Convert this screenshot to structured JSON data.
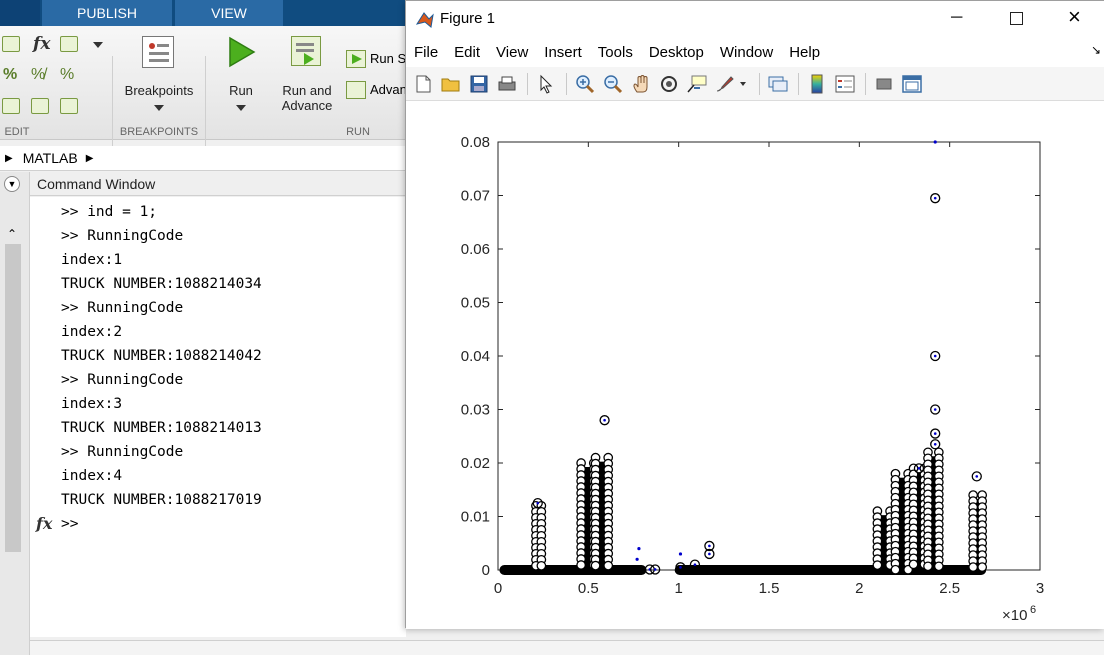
{
  "desktop": {
    "tabs": [
      "PUBLISH",
      "VIEW"
    ],
    "toolstrip": {
      "breakpoints_label": "Breakpoints",
      "run_label": "Run",
      "run_advance_label_1": "Run and",
      "run_advance_label_2": "Advance",
      "run_section_label": "Run S",
      "advance_label": "Advan",
      "section_edit": "EDIT",
      "section_breakpoints": "BREAKPOINTS",
      "section_run": "RUN"
    },
    "address": "MATLAB",
    "command_window_title": "Command Window",
    "command_lines": [
      ">> ind = 1;",
      ">> RunningCode",
      "index:1",
      "TRUCK NUMBER:1088214034",
      ">> RunningCode",
      "index:2",
      "TRUCK NUMBER:1088214042",
      ">> RunningCode",
      "index:3",
      "TRUCK NUMBER:1088214013",
      ">> RunningCode",
      "index:4",
      "TRUCK NUMBER:1088217019",
      ">>"
    ],
    "fx_prompt": "fx"
  },
  "figure": {
    "title": "Figure 1",
    "menus": [
      "File",
      "Edit",
      "View",
      "Insert",
      "Tools",
      "Desktop",
      "Window",
      "Help"
    ],
    "toolbar_icons": [
      "new-figure-icon",
      "open-icon",
      "save-icon",
      "print-icon",
      "pointer-icon",
      "zoom-in-icon",
      "zoom-out-icon",
      "pan-icon",
      "rotate-icon",
      "data-cursor-icon",
      "brush-icon",
      "link-icon",
      "colorbar-icon",
      "legend-icon",
      "hide-tools-icon",
      "dock-icon"
    ],
    "colors": {
      "marker_black": "#000000",
      "marker_blue": "#0000cc"
    }
  },
  "chart_data": {
    "type": "scatter",
    "title": "",
    "xlabel": "",
    "ylabel": "",
    "xlim": [
      0,
      3000000
    ],
    "ylim": [
      0,
      0.08
    ],
    "xticks": [
      0,
      0.5,
      1,
      1.5,
      2,
      2.5,
      3
    ],
    "xtick_labels": [
      "0",
      "0.5",
      "1",
      "1.5",
      "2",
      "2.5",
      "3"
    ],
    "x_exponent_label": "×10",
    "x_exponent_power": "6",
    "yticks": [
      0,
      0.01,
      0.02,
      0.03,
      0.04,
      0.05,
      0.06,
      0.07,
      0.08
    ],
    "ytick_labels": [
      "0",
      "0.01",
      "0.02",
      "0.03",
      "0.04",
      "0.05",
      "0.06",
      "0.07",
      "0.08"
    ],
    "grid": false,
    "baseline_segments": [
      [
        30000,
        800000
      ],
      [
        1000000,
        2680000
      ]
    ],
    "clusters": [
      {
        "x": [
          210000,
          240000
        ],
        "ymax": 0.012
      },
      {
        "x": [
          460000,
          530000
        ],
        "ymax": 0.02
      },
      {
        "x": [
          540000,
          610000
        ],
        "ymax": 0.021
      },
      {
        "x": [
          2100000,
          2170000
        ],
        "ymax": 0.011
      },
      {
        "x": [
          2200000,
          2270000
        ],
        "ymax": 0.018
      },
      {
        "x": [
          2300000,
          2360000
        ],
        "ymax": 0.019
      },
      {
        "x": [
          2380000,
          2440000
        ],
        "ymax": 0.022
      },
      {
        "x": [
          2630000,
          2680000
        ],
        "ymax": 0.014
      }
    ],
    "series": [
      {
        "marker": "circle",
        "points": [
          [
            590000,
            0.028
          ],
          [
            2420000,
            0.0695
          ],
          [
            2420000,
            0.04
          ],
          [
            2420000,
            0.03
          ],
          [
            2420000,
            0.0255
          ],
          [
            2420000,
            0.0235
          ],
          [
            2650000,
            0.0175
          ],
          [
            2330000,
            0.019
          ],
          [
            1170000,
            0.0045
          ],
          [
            1170000,
            0.003
          ],
          [
            1090000,
            0.001
          ],
          [
            1010000,
            0.0005
          ],
          [
            840000,
            0.0001
          ],
          [
            870000,
            0.0001
          ],
          [
            220000,
            0.0125
          ]
        ]
      },
      {
        "marker": "dot",
        "points": [
          [
            2420000,
            0.08
          ],
          [
            780000,
            0.004
          ],
          [
            770000,
            0.002
          ],
          [
            1010000,
            0.003
          ]
        ]
      }
    ]
  }
}
